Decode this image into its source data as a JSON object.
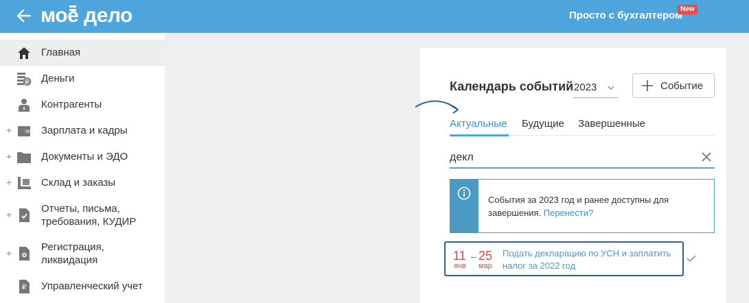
{
  "header": {
    "logo": "моё дело",
    "promo_text": "Просто с бухгалтером",
    "promo_badge": "New"
  },
  "sidebar": {
    "items": [
      {
        "label": "Главная",
        "icon": "home-icon",
        "expandable": false,
        "active": true
      },
      {
        "label": "Деньги",
        "icon": "money-icon",
        "expandable": false,
        "active": false
      },
      {
        "label": "Контрагенты",
        "icon": "contractor-icon",
        "expandable": false,
        "active": false
      },
      {
        "label": "Зарплата и кадры",
        "icon": "wallet-icon",
        "expandable": true,
        "active": false
      },
      {
        "label": "Документы и ЭДО",
        "icon": "folder-icon",
        "expandable": true,
        "active": false
      },
      {
        "label": "Склад и заказы",
        "icon": "warehouse-icon",
        "expandable": true,
        "active": false
      },
      {
        "label": "Отчеты, письма,\nтребования, КУДИР",
        "icon": "report-icon",
        "expandable": true,
        "active": false
      },
      {
        "label": "Регистрация,\nликвидация",
        "icon": "registration-icon",
        "expandable": true,
        "active": false
      },
      {
        "label": "Управленческий учет",
        "icon": "management-icon",
        "expandable": false,
        "active": false
      }
    ]
  },
  "calendar": {
    "title": "Календарь событий",
    "year": "2023",
    "add_event_label": "Событие",
    "tabs": [
      {
        "label": "Актуальные",
        "active": true
      },
      {
        "label": "Будущие",
        "active": false
      },
      {
        "label": "Завершенные",
        "active": false
      }
    ],
    "search_value": "декл",
    "info_text": "События за 2023 год и ранее доступны для завершения.",
    "info_link": "Перенести?",
    "events": [
      {
        "start_day": "11",
        "start_month": "янв",
        "separator": "–",
        "end_day": "25",
        "end_month": "мар",
        "text": "Подать декларацию по УСН и заплатить налог за 2022 год"
      }
    ]
  },
  "colors": {
    "header_bg": "#4ea5dd",
    "accent": "#3a8fd1",
    "info_border": "#4a9ac4",
    "date_red": "#e0454a",
    "event_border": "#2f5f9a",
    "badge_red": "#e84c4c"
  }
}
